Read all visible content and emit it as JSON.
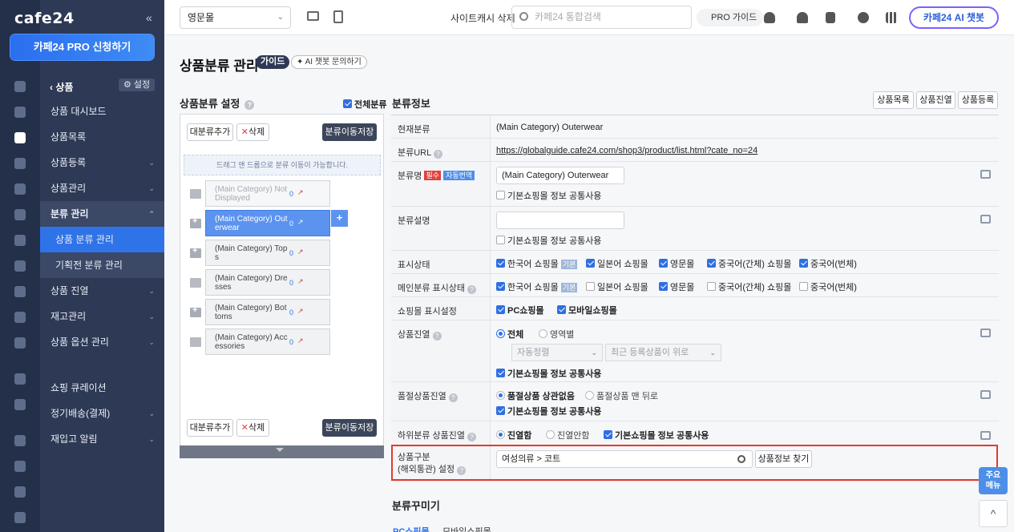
{
  "nav": {
    "logo": "cafe24",
    "collapse": "«",
    "pro_button": "카페24 PRO 신청하기",
    "section": {
      "back": "상품",
      "setting": "설정"
    },
    "items": [
      {
        "label": "상품 대시보드"
      },
      {
        "label": "상품목록"
      },
      {
        "label": "상품등록"
      },
      {
        "label": "상품관리"
      },
      {
        "label": "분류 관리"
      },
      {
        "label": "상품 분류 관리"
      },
      {
        "label": "기획전 분류 관리"
      },
      {
        "label": "상품 진열"
      },
      {
        "label": "재고관리"
      },
      {
        "label": "상품 옵션 관리"
      },
      {
        "label": "쇼핑 큐레이션"
      },
      {
        "label": "정기배송(결제)"
      },
      {
        "label": "재입고 알림"
      }
    ]
  },
  "topbar": {
    "mall": "영문몰",
    "cache": "사이트캐시 삭제",
    "search_placeholder": "카페24 통합검색",
    "pro_guide": "PRO 가이드",
    "chatbot": "카페24 AI 챗봇"
  },
  "page": {
    "title": "상품분류 관리",
    "guide": "가이드",
    "ai_ask": "AI 챗봇 문의하기"
  },
  "tree": {
    "title": "상품분류 설정",
    "all_category": "전체분류",
    "add_top": "대분류추가",
    "delete": "삭제",
    "save_move": "분류이동저장",
    "drag_note": "드래그 앤 드롭으로 분류 이동이 가능합니다.",
    "items": [
      {
        "line1": "(Main Category) Not",
        "line2": "Displayed",
        "count": "0"
      },
      {
        "line1": "(Main Category) Out",
        "line2": "erwear",
        "count": "0"
      },
      {
        "line1": "(Main Category) Top",
        "line2": "s",
        "count": "0"
      },
      {
        "line1": "(Main Category) Dre",
        "line2": "sses",
        "count": "0"
      },
      {
        "line1": "(Main Category) Bot",
        "line2": "toms",
        "count": "0"
      },
      {
        "line1": "(Main Category) Acc",
        "line2": "essories",
        "count": "0"
      }
    ]
  },
  "info": {
    "title": "분류정보",
    "btn_list": "상품목록",
    "btn_display": "상품진열",
    "btn_register": "상품등록",
    "current_label": "현재분류",
    "current_value": "(Main Category) Outerwear",
    "url_label": "분류URL",
    "url_value": "https://globalguide.cafe24.com/shop3/product/list.html?cate_no=24",
    "name_label": "분류명",
    "required": "필수",
    "auto_translate": "자동번역",
    "name_value": "(Main Category) Outerwear",
    "share_basic": "기본쇼핑몰 정보 공통사용",
    "desc_label": "분류설명",
    "status_label": "표시상태",
    "main_status_label": "메인분류 표시상태",
    "malls": [
      "한국어 쇼핑몰",
      "일본어 쇼핑몰",
      "영문몰",
      "중국어(간체) 쇼핑몰",
      "중국어(번체)"
    ],
    "basic_tag": "기본",
    "mall_display_label": "쇼핑몰 표시설정",
    "pc_mall": "PC쇼핑몰",
    "mobile_mall": "모바일쇼핑몰",
    "product_display_label": "상품진열",
    "all": "전체",
    "by_area": "영역별",
    "auto_sort": "자동정렬",
    "recent_first": "최근 등록상품이 위로",
    "soldout_label": "품절상품진열",
    "soldout_ignore": "품절상품 상관없음",
    "soldout_back": "품절상품 맨 뒤로",
    "sub_label": "하위분류 상품진열",
    "display_yes": "진열함",
    "display_no": "진열안함",
    "class_label_1": "상품구분",
    "class_label_2": "(해외통관) 설정",
    "class_value": "여성의류 > 코트",
    "find_button": "상품정보 찾기"
  },
  "decor": {
    "title": "분류꾸미기",
    "pc_tab": "PC쇼핑몰",
    "mobile_tab": "모바일쇼핑몰"
  },
  "float": {
    "quick_menu_1": "주요",
    "quick_menu_2": "메뉴",
    "top": "^"
  },
  "colors": {
    "nav_bg": "#2d3955",
    "accent": "#2f73e8",
    "highlight": "#e23b2e"
  }
}
